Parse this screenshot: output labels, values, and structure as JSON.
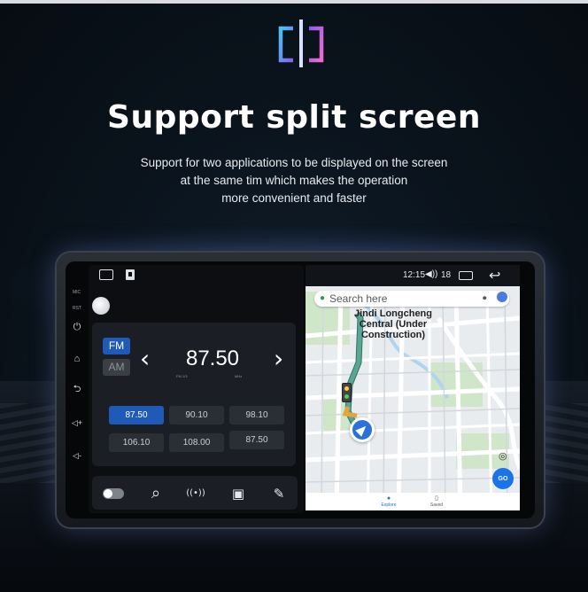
{
  "hero": {
    "title": "Support split screen",
    "description_lines": [
      "Support for two applications to be displayed on the screen",
      "at the same tim which makes the operation",
      "more convenient and faster"
    ],
    "icon": "split-screen-icon",
    "icon_colors": [
      "#46c6f2",
      "#8a5cf0",
      "#f06acb"
    ]
  },
  "device": {
    "side_labels": [
      "MIC",
      "RST"
    ],
    "side_buttons": [
      {
        "icon": "power-icon",
        "glyph": "⏻"
      },
      {
        "icon": "home-icon",
        "glyph": "⌂"
      },
      {
        "icon": "back-icon",
        "glyph": "⮌"
      },
      {
        "icon": "volume-up-icon",
        "glyph": "◁+"
      },
      {
        "icon": "volume-down-icon",
        "glyph": "◁-"
      }
    ]
  },
  "radio": {
    "bands": [
      "FM",
      "AM"
    ],
    "active_band": "FM",
    "frequency": "87.50",
    "freq_sub_left": "FM 1/3",
    "freq_sub_right": "MHz",
    "prev_glyph": "‹",
    "next_glyph": "›",
    "presets": [
      "87.50",
      "90.10",
      "98.10",
      "106.10",
      "108.00",
      "87.50"
    ],
    "active_preset_index": 0
  },
  "dock": {
    "items": [
      {
        "name": "toggle-icon",
        "glyph": ""
      },
      {
        "name": "search-icon",
        "glyph": "⌕"
      },
      {
        "name": "radio-signal-icon",
        "glyph": "((•))"
      },
      {
        "name": "save-icon",
        "glyph": "▣"
      },
      {
        "name": "edit-icon",
        "glyph": "✎"
      }
    ]
  },
  "statusbar": {
    "time": "12:15",
    "volume": "18",
    "volume_glyph": "◀))",
    "back_glyph": "↩"
  },
  "map": {
    "search_placeholder": "Search here",
    "place_label_lines": [
      "Jindi Longcheng",
      "Central (Under",
      "Construction)"
    ],
    "go_label": "GO",
    "tabs": [
      {
        "label": "Explore",
        "glyph": "●"
      },
      {
        "label": "Saved",
        "glyph": "▯"
      }
    ],
    "route_color": "#5aa595",
    "roads_color": "#ffffff",
    "park_color": "#cfe6c8",
    "water_color": "#aed4f0"
  },
  "colors": {
    "accent_blue": "#1f5ab8",
    "background": "#0a131c"
  }
}
